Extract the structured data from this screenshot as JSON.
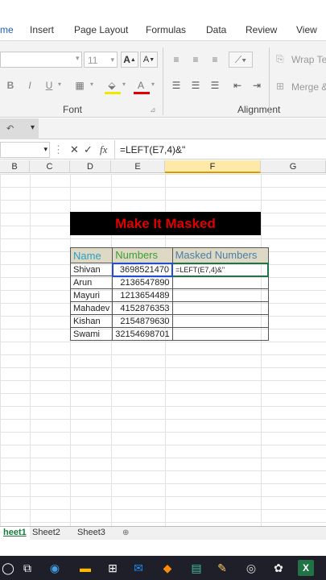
{
  "ribbon": {
    "tabs": [
      "me",
      "Insert",
      "Page Layout",
      "Formulas",
      "Data",
      "Review",
      "View"
    ],
    "font_size": "11",
    "wrap_text": "Wrap Te",
    "merge": "Merge &",
    "group_font": "Font",
    "group_alignment": "Alignment",
    "bold": "B",
    "italic": "I",
    "underline": "U",
    "grow_font": "A",
    "shrink_font": "A"
  },
  "formula_bar": {
    "cancel": "✕",
    "enter": "✓",
    "fx": "fx",
    "content": "=LEFT(E7,4)&\""
  },
  "columns": [
    "B",
    "C",
    "D",
    "E",
    "F",
    "G"
  ],
  "sheet": {
    "title": "Make It Masked",
    "headers": [
      "Name",
      "Numbers",
      "Masked Numbers"
    ],
    "editing_cell": "=LEFT(E7,4)&\"",
    "rows": [
      {
        "name": "Shivan",
        "number": "3698521470"
      },
      {
        "name": "Arun",
        "number": "2136547890"
      },
      {
        "name": "Mayuri",
        "number": "1213654489"
      },
      {
        "name": "Mahadev",
        "number": "4152876353"
      },
      {
        "name": "Kishan",
        "number": "2154879630"
      },
      {
        "name": "Swami",
        "number": "32154698701"
      }
    ]
  },
  "sheet_tabs": [
    "heet1",
    "Sheet2",
    "Sheet3"
  ],
  "colors": {
    "title_text": "#e00000",
    "header_fill": "#ddd9c4",
    "accent": "#217346"
  }
}
